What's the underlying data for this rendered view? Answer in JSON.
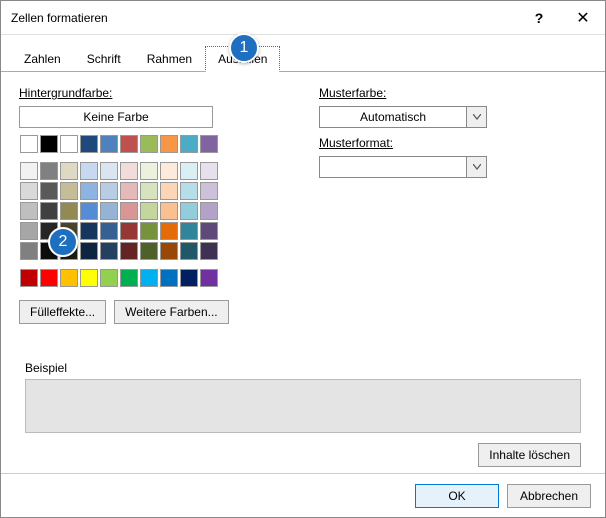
{
  "title": "Zellen formatieren",
  "help_char": "?",
  "close_char": "✕",
  "tabs": {
    "zahlen": "Zahlen",
    "schrift": "Schrift",
    "rahmen": "Rahmen",
    "ausfuellen": "Ausfüllen"
  },
  "left": {
    "bg_label": "Hintergrundfarbe:",
    "no_fill": "Keine Farbe",
    "fill_effects": "Fülleffekte...",
    "more_colors": "Weitere Farben..."
  },
  "right": {
    "pattern_color_label": "Musterfarbe:",
    "pattern_color_value": "Automatisch",
    "pattern_format_label": "Musterformat:",
    "pattern_format_value": ""
  },
  "sample_label": "Beispiel",
  "clear_content": "Inhalte löschen",
  "ok": "OK",
  "cancel": "Abbrechen",
  "callouts": {
    "one": "1",
    "two": "2"
  },
  "swatch_rows": {
    "section1": [
      [
        "#ffffff",
        "#000000",
        "#ffffff",
        "#1f497d",
        "#4f81bd",
        "#c0504d",
        "#9bbb59",
        "#f79646",
        "#4bacc6",
        "#8064a2"
      ]
    ],
    "section2": [
      [
        "#f2f2f2",
        "#808080",
        "#ddd9c3",
        "#c6d9f0",
        "#dbe5f1",
        "#f2dcdb",
        "#ebf1dd",
        "#fdeada",
        "#dbeef3",
        "#e5e0ec"
      ],
      [
        "#d9d9d9",
        "#595959",
        "#c4bd97",
        "#8db3e2",
        "#b8cce4",
        "#e5b9b7",
        "#d7e3bc",
        "#fbd5b5",
        "#b7dde8",
        "#ccc1d9"
      ],
      [
        "#bfbfbf",
        "#404040",
        "#938953",
        "#548dd4",
        "#95b3d7",
        "#d99694",
        "#c3d69b",
        "#fac08f",
        "#92cddc",
        "#b2a2c7"
      ],
      [
        "#a6a6a6",
        "#262626",
        "#494429",
        "#17365d",
        "#366092",
        "#953734",
        "#76923c",
        "#e36c09",
        "#31859b",
        "#5f497a"
      ],
      [
        "#808080",
        "#0d0d0d",
        "#1d1b10",
        "#0f243e",
        "#244061",
        "#632423",
        "#4f6128",
        "#974806",
        "#205867",
        "#3f3151"
      ]
    ],
    "section3": [
      [
        "#c00000",
        "#ff0000",
        "#ffc000",
        "#ffff00",
        "#92d050",
        "#00b050",
        "#00b0f0",
        "#0070c0",
        "#002060",
        "#7030a0"
      ]
    ]
  }
}
